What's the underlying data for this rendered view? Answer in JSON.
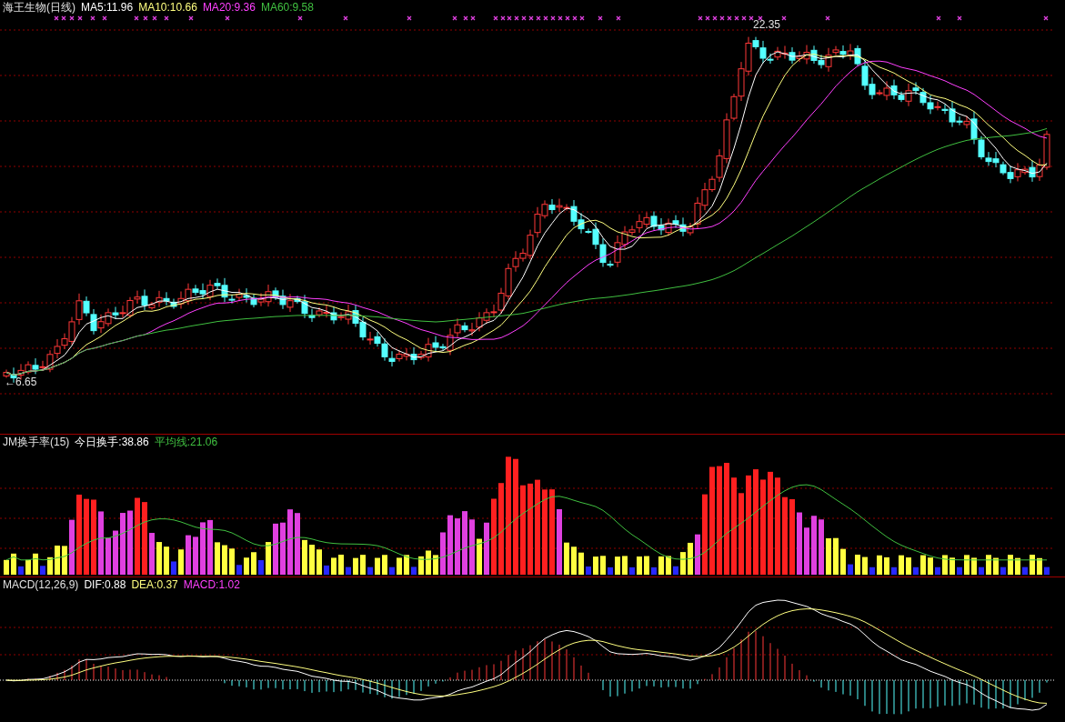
{
  "stock_panel": {
    "title": "海王生物(日线)",
    "indicators": [
      {
        "label": "MA5:11.96",
        "color": "#ffffff"
      },
      {
        "label": "MA10:10.66",
        "color": "#ffff80"
      },
      {
        "label": "MA20:9.36",
        "color": "#ff40ff"
      },
      {
        "label": "MA60:9.58",
        "color": "#40c040"
      }
    ],
    "high_label": "22.35",
    "low_label": "←6.65"
  },
  "turnover_panel": {
    "title": "JM换手率(15)",
    "indicators": [
      {
        "label": "今日换手:38.86",
        "color": "#ffffff"
      },
      {
        "label": "平均线:21.06",
        "color": "#40c040"
      }
    ]
  },
  "macd_panel": {
    "title": "MACD(12,26,9)",
    "indicators": [
      {
        "label": "DIF:0.88",
        "color": "#ffffff"
      },
      {
        "label": "DEA:0.37",
        "color": "#ffff80"
      },
      {
        "label": "MACD:1.02",
        "color": "#ff40ff"
      }
    ]
  }
}
